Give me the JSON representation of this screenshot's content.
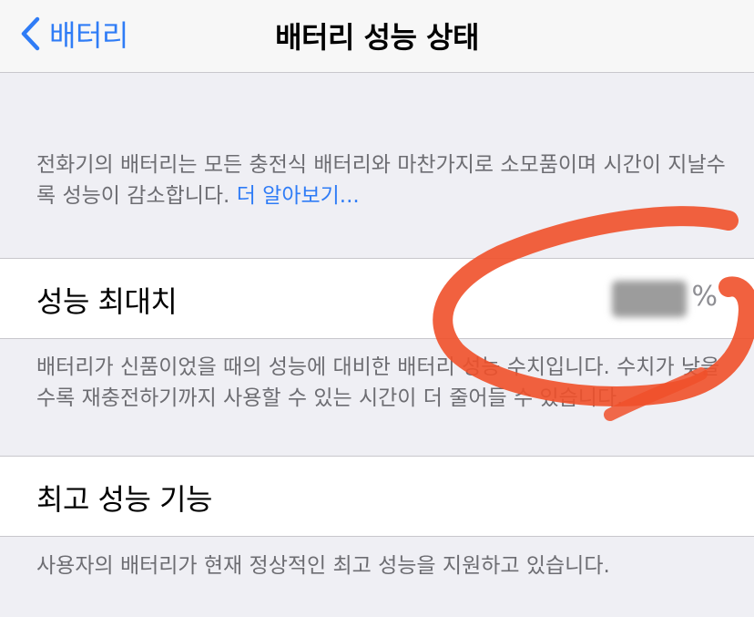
{
  "navbar": {
    "back_label": "배터리",
    "back_icon": "chevron-left-icon",
    "title": "배터리 성능 상태"
  },
  "intro": {
    "text": "전화기의 배터리는 모든 충전식 배터리와 마찬가지로 소모품이며 시간이 지날수록 성능이 감소합니다. ",
    "link": "더 알아보기..."
  },
  "max_capacity": {
    "label": "성능 최대치",
    "unit": "%",
    "description": "배터리가 신품이었을 때의 성능에 대비한 배터리 성능 수치입니다. 수치가 낮을수록 재충전하기까지 사용할 수 있는 시간이 더 줄어들 수 있습니다."
  },
  "peak_performance": {
    "label": "최고 성능 기능",
    "description": "사용자의 배터리가 현재 정상적인 최고 성능을 지원하고 있습니다."
  },
  "colors": {
    "accent": "#2f7cf6",
    "background": "#efeff4",
    "annotation": "#f0502a"
  }
}
